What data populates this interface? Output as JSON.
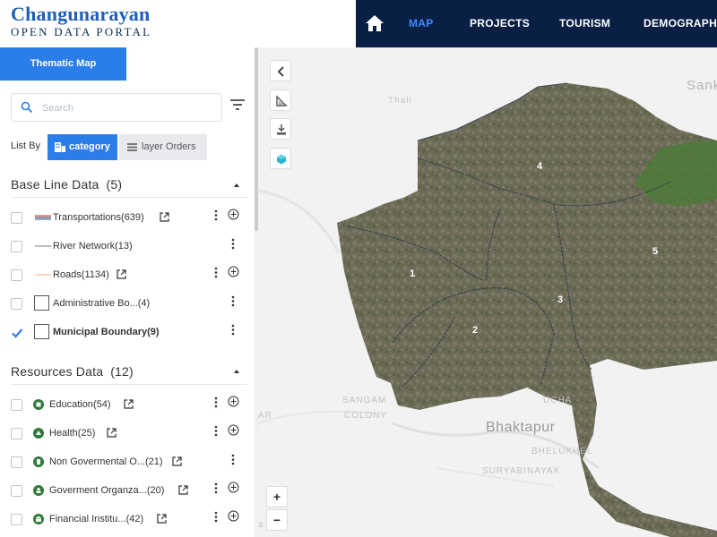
{
  "brand": {
    "title": "Changunarayan",
    "subtitle": "OPEN DATA PORTAL"
  },
  "nav": {
    "home_icon": "home-icon",
    "items": [
      {
        "label": "MAP",
        "active": true
      },
      {
        "label": "PROJECTS",
        "active": false
      },
      {
        "label": "TOURISM",
        "active": false
      },
      {
        "label": "DEMOGRAPHY",
        "active": false
      }
    ]
  },
  "sidebar": {
    "tab": "Thematic Map",
    "search": {
      "placeholder": "Search",
      "value": ""
    },
    "list_by": {
      "label": "List By",
      "category": "category",
      "layer_orders": "layer Orders"
    },
    "groups": [
      {
        "title": "Base Line Data",
        "count": "(5)",
        "layers": [
          {
            "name": "Transportations",
            "count": "(639)",
            "checked": false,
            "symbol": "transport-line",
            "has_link": true,
            "has_add": true
          },
          {
            "name": "River Network",
            "count": "(13)",
            "checked": false,
            "symbol": "river-line",
            "has_link": false,
            "has_add": false
          },
          {
            "name": "Roads",
            "count": "(1134)",
            "checked": false,
            "symbol": "road-line",
            "has_link": true,
            "has_add": true
          },
          {
            "name": "Administrative Bo...",
            "count": "(4)",
            "checked": false,
            "symbol": "polygon-box",
            "has_link": false,
            "has_add": false
          },
          {
            "name": "Municipal Boundary",
            "count": "(9)",
            "checked": true,
            "symbol": "polygon-box",
            "has_link": false,
            "has_add": false
          }
        ]
      },
      {
        "title": "Resources Data",
        "count": "(12)",
        "layers": [
          {
            "name": "Education",
            "count": "(54)",
            "checked": false,
            "symbol": "education-icon",
            "has_link": true,
            "has_add": true
          },
          {
            "name": "Health",
            "count": "(25)",
            "checked": false,
            "symbol": "health-icon",
            "has_link": true,
            "has_add": true
          },
          {
            "name": "Non Govermental O...",
            "count": "(21)",
            "checked": false,
            "symbol": "ngo-icon",
            "has_link": true,
            "has_add": false
          },
          {
            "name": "Goverment Organza...",
            "count": "(20)",
            "checked": false,
            "symbol": "government-icon",
            "has_link": true,
            "has_add": true
          },
          {
            "name": "Financial Institu...",
            "count": "(42)",
            "checked": false,
            "symbol": "bank-icon",
            "has_link": true,
            "has_add": true
          }
        ]
      }
    ]
  },
  "map": {
    "place_labels": [
      "Thali",
      "Sank",
      "SANGAM",
      "COLONY",
      "Bhaktapur",
      "BHELUKHEL",
      "SURYABINAYAK",
      "UCHA",
      "AR",
      "a"
    ],
    "ward_labels": [
      "1",
      "2",
      "3",
      "4",
      "5"
    ],
    "zoom_in": "+",
    "zoom_out": "−",
    "colors": {
      "boundary": "#3b4a55",
      "imagery": "#6b6a58",
      "accent": "#2b7de9",
      "nav_bg": "#0a1f44"
    }
  }
}
